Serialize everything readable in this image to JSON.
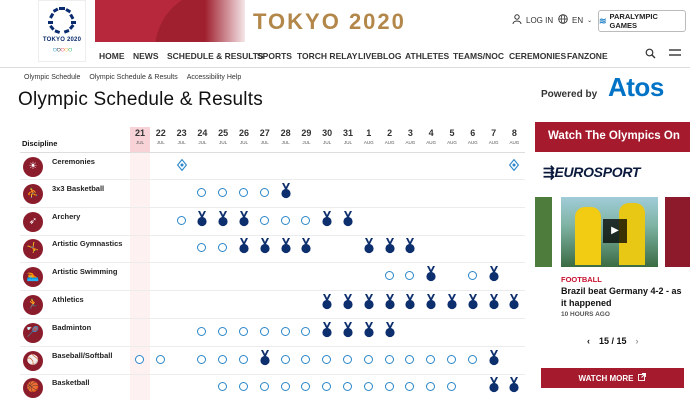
{
  "header": {
    "logo_text": "TOKYO 2020",
    "site_title": "TOKYO 2020",
    "login": "LOG IN",
    "language": "EN",
    "paralympic": "PARALYMPIC GAMES"
  },
  "nav": [
    "HOME",
    "NEWS",
    "SCHEDULE & RESULTS",
    "SPORTS",
    "TORCH RELAY",
    "LIVEBLOG",
    "ATHLETES",
    "TEAMS/NOC",
    "CEREMONIES",
    "FANZONE"
  ],
  "breadcrumbs": [
    "Olympic Schedule",
    "Olympic Schedule & Results",
    "Accessibility Help"
  ],
  "page_title": "Olympic Schedule & Results",
  "powered_by": "Powered by",
  "sponsor": "Atos",
  "schedule": {
    "discipline_header": "Discipline",
    "dates": [
      {
        "day": "21",
        "month": "JUL",
        "highlight": true
      },
      {
        "day": "22",
        "month": "JUL"
      },
      {
        "day": "23",
        "month": "JUL"
      },
      {
        "day": "24",
        "month": "JUL"
      },
      {
        "day": "25",
        "month": "JUL"
      },
      {
        "day": "26",
        "month": "JUL"
      },
      {
        "day": "27",
        "month": "JUL"
      },
      {
        "day": "28",
        "month": "JUL"
      },
      {
        "day": "29",
        "month": "JUL"
      },
      {
        "day": "30",
        "month": "JUL"
      },
      {
        "day": "31",
        "month": "JUL"
      },
      {
        "day": "1",
        "month": "AUG"
      },
      {
        "day": "2",
        "month": "AUG"
      },
      {
        "day": "3",
        "month": "AUG"
      },
      {
        "day": "4",
        "month": "AUG"
      },
      {
        "day": "5",
        "month": "AUG"
      },
      {
        "day": "6",
        "month": "AUG"
      },
      {
        "day": "7",
        "month": "AUG"
      },
      {
        "day": "8",
        "month": "AUG"
      }
    ],
    "sports": [
      {
        "name": "Ceremonies",
        "icon": "ceremony-icon",
        "glyph": "☀",
        "cells": "--c---------------c"
      },
      {
        "name": "3x3 Basketball",
        "icon": "basketball-3x3-icon",
        "glyph": "⛹",
        "cells": "---oooom-----------"
      },
      {
        "name": "Archery",
        "icon": "archery-icon",
        "glyph": "➶",
        "cells": "--ommmooomm---------"
      },
      {
        "name": "Artistic Gymnastics",
        "icon": "gymnastics-icon",
        "glyph": "🤸",
        "cells": "---oommmm--mmm------"
      },
      {
        "name": "Artistic Swimming",
        "icon": "swimming-icon",
        "glyph": "🏊",
        "cells": "------------oom-om-"
      },
      {
        "name": "Athletics",
        "icon": "athletics-icon",
        "glyph": "🏃",
        "cells": "---------mmmmmmmmmm"
      },
      {
        "name": "Badminton",
        "icon": "badminton-icon",
        "glyph": "🏸",
        "cells": "---oooooommmm------"
      },
      {
        "name": "Baseball/Softball",
        "icon": "baseball-icon",
        "glyph": "⚾",
        "cells": "oo-ooomoooooooooom-"
      },
      {
        "name": "Basketball",
        "icon": "basketball-icon",
        "glyph": "🏀",
        "cells": "----oooooooooooo-mm"
      }
    ]
  },
  "sidebar": {
    "title": "Watch The Olympics On",
    "broadcaster": "EUROSPORT",
    "kicker": "FOOTBALL",
    "headline": "Brazil beat Germany 4-2 - as it happened",
    "time_ago": "10 HOURS AGO",
    "pager": "15 / 15",
    "watch_more": "WATCH MORE"
  },
  "colors": {
    "brand_red": "#a51a2d",
    "gold": "#b3874a",
    "medal_blue": "#0d2f6e",
    "session_blue": "#2a86c9"
  }
}
